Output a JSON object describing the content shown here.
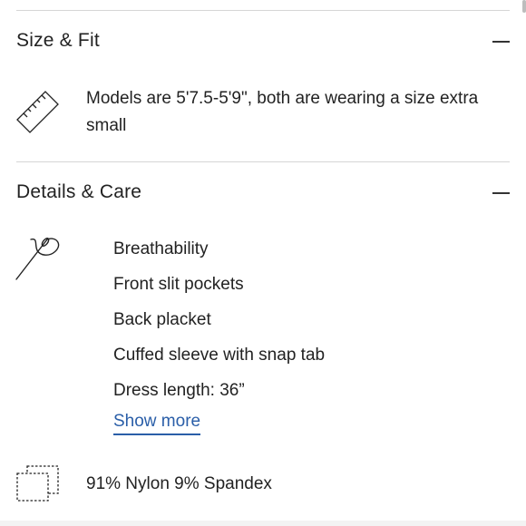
{
  "size_fit": {
    "title": "Size & Fit",
    "icon": "ruler-icon",
    "text": "Models are 5'7.5-5'9\", both are wearing a size extra small"
  },
  "details_care": {
    "title": "Details & Care",
    "icon": "needle-thread-icon",
    "items": [
      "Breathability",
      "Front slit pockets",
      "Back placket",
      "Cuffed sleeve with snap tab",
      "Dress length: 36”"
    ],
    "show_more": "Show more"
  },
  "material": {
    "icon": "fabric-swatch-icon",
    "text": "91% Nylon 9% Spandex"
  },
  "colors": {
    "link": "#2a5ea8",
    "divider": "#d6d6d6"
  }
}
